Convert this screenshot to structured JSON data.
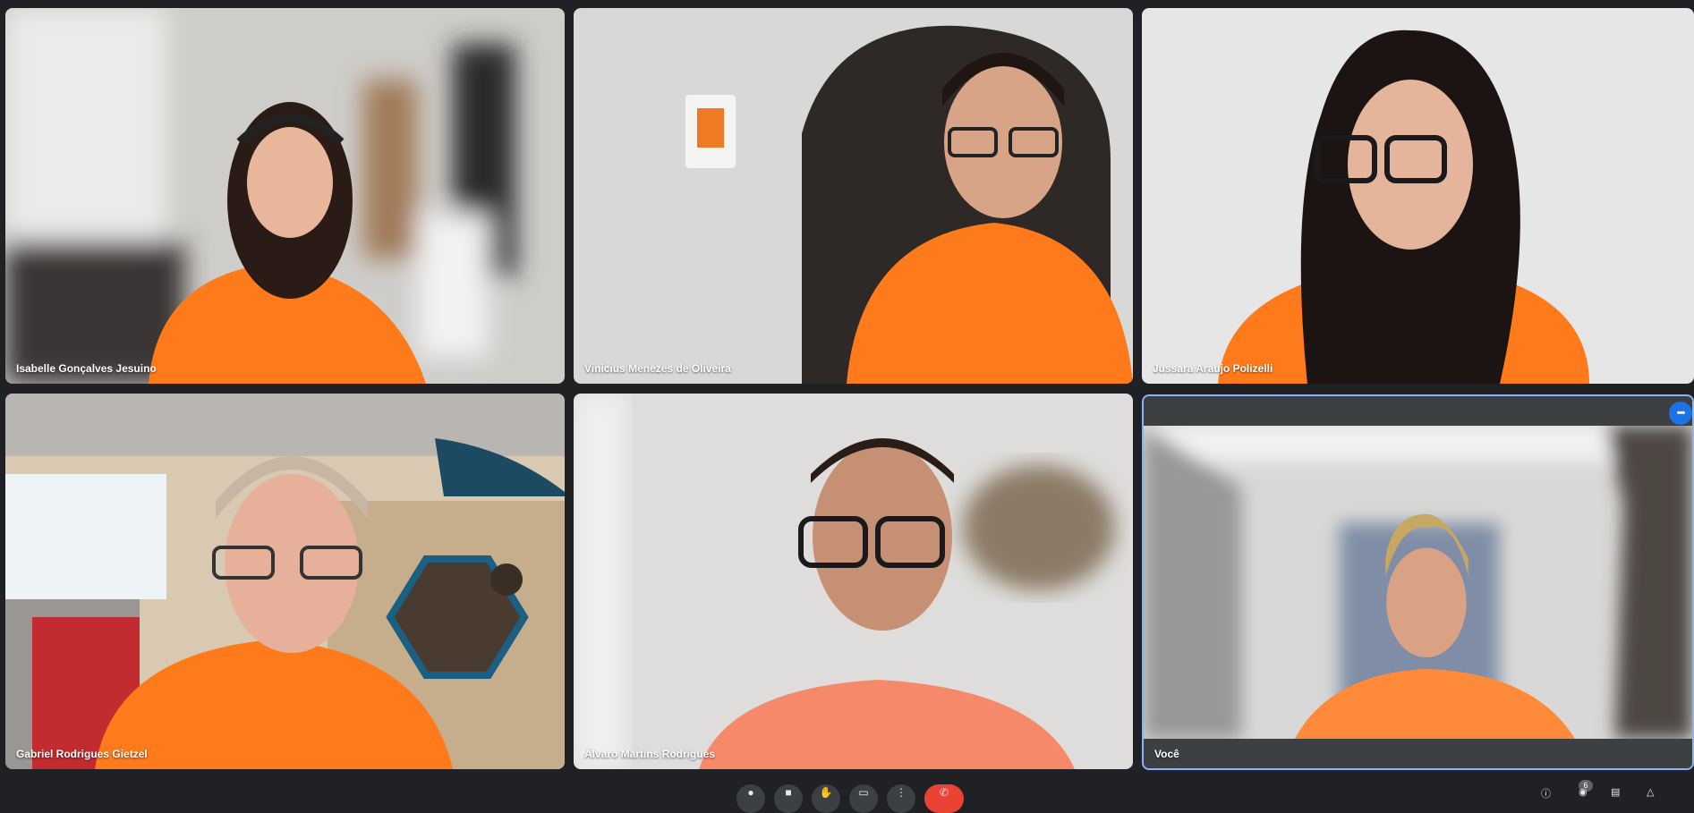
{
  "participants": [
    {
      "name": "Isabelle Gonçalves Jesuino"
    },
    {
      "name": "Vinicius Menezes de Oliveira"
    },
    {
      "name": "Jussara Araujo Polizelli"
    },
    {
      "name": "Gabriel Rodrigues Gietzel"
    },
    {
      "name": "Álvaro Martins Rodrigues"
    },
    {
      "name": "Você"
    }
  ],
  "self_tile": {
    "more_icon": "more-horiz-icon",
    "more_glyph": "•••"
  },
  "controls": {
    "participants_count": "6",
    "buttons": [
      "mic-icon",
      "camera-icon",
      "hand-icon",
      "present-icon",
      "more-vert-icon",
      "end-call-icon"
    ]
  },
  "colors": {
    "background": "#202124",
    "tile": "#3c4043",
    "active_border": "#8ab4f8",
    "end_call": "#ea4335",
    "shirt_orange": "#ff7a1a"
  }
}
